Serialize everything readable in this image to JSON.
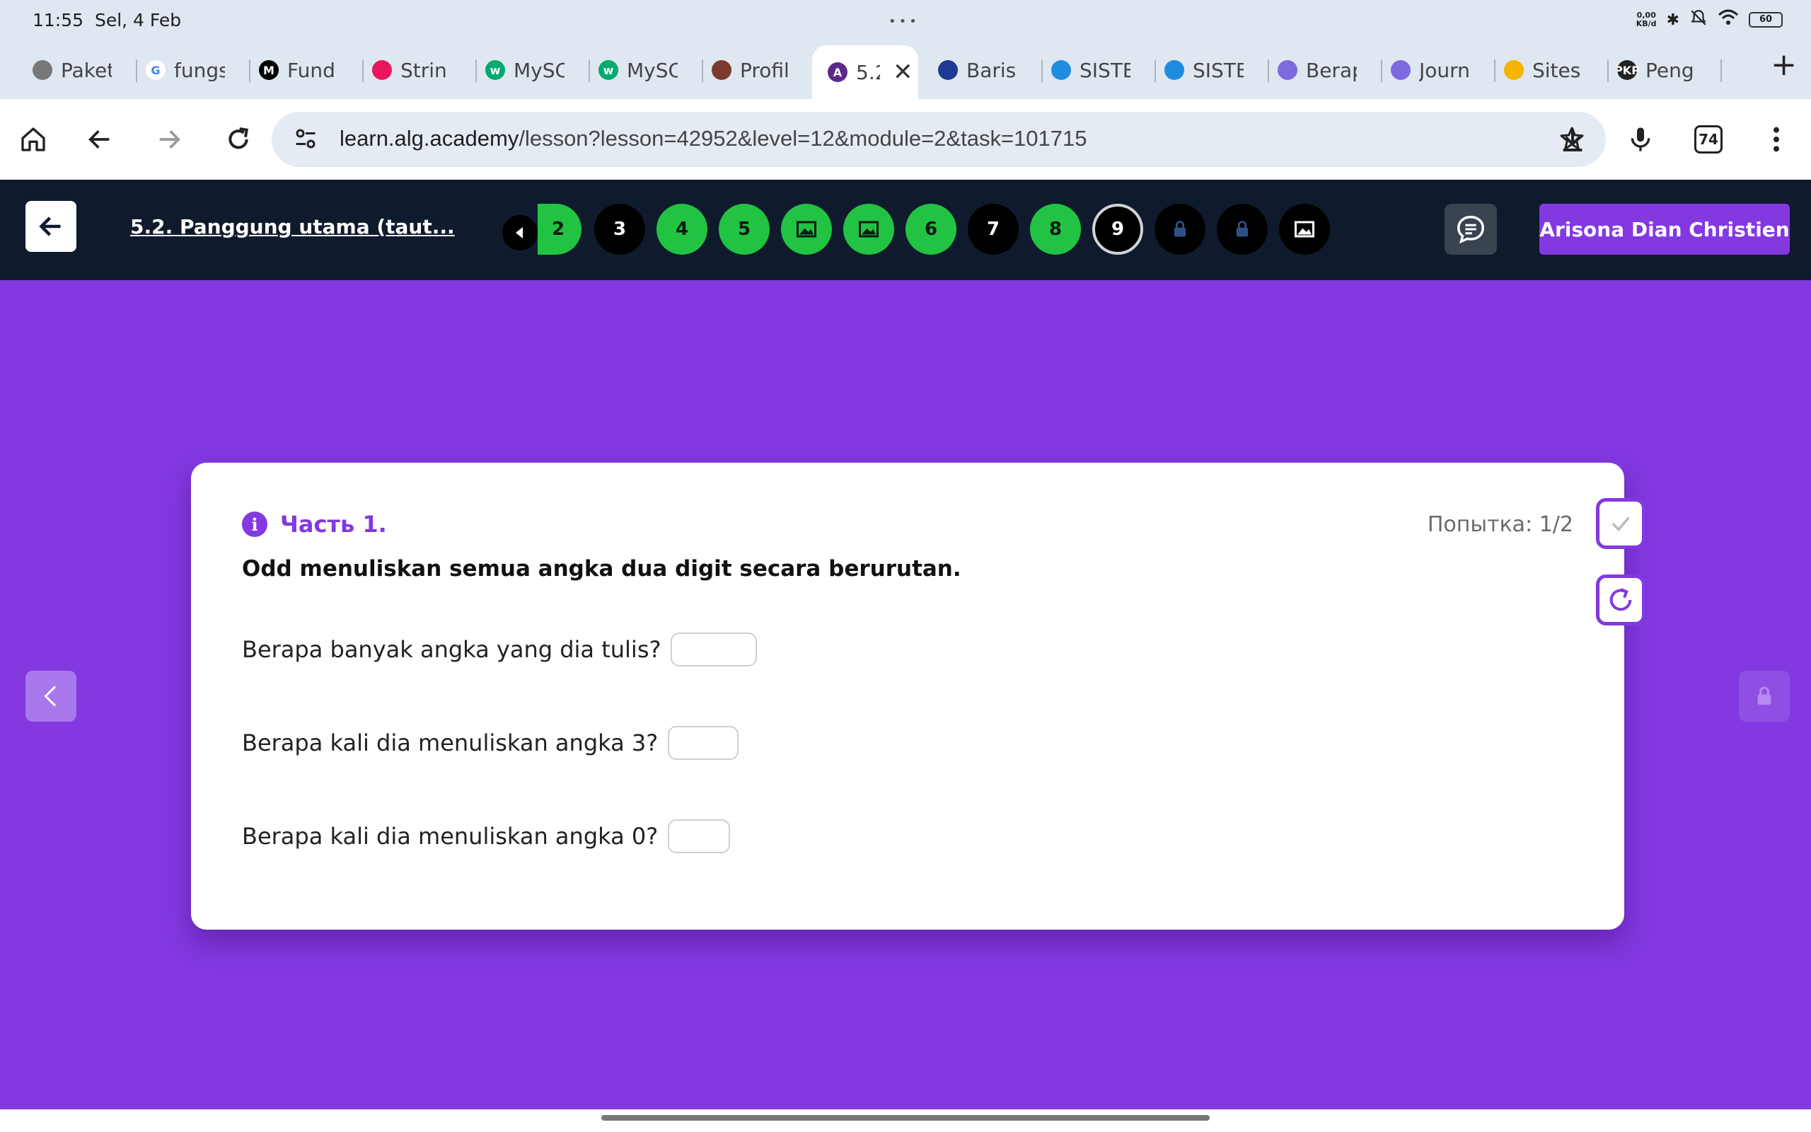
{
  "status": {
    "time": "11:55",
    "date": "Sel, 4 Feb",
    "net_top": "0,00",
    "net_bottom": "KB/d",
    "battery": "60"
  },
  "tabs": [
    {
      "label": "Paket",
      "fav_color": "#777777",
      "fav_text": ""
    },
    {
      "label": "fungs",
      "fav_color": "#ffffff",
      "fav_text": "G"
    },
    {
      "label": "Fund",
      "fav_color": "#000000",
      "fav_text": "M"
    },
    {
      "label": "Strin",
      "fav_color": "#e8175d",
      "fav_text": ""
    },
    {
      "label": "MySC",
      "fav_color": "#04aa6d",
      "fav_text": "w"
    },
    {
      "label": "MySC",
      "fav_color": "#04aa6d",
      "fav_text": "w"
    },
    {
      "label": "Profil",
      "fav_color": "#7a3b2e",
      "fav_text": ""
    },
    {
      "label": "5.2",
      "fav_color": "#5b2a86",
      "fav_text": "A",
      "active": true
    },
    {
      "label": "Baris",
      "fav_color": "#1f3a93",
      "fav_text": ""
    },
    {
      "label": "SISTE",
      "fav_color": "#1f8ce0",
      "fav_text": ""
    },
    {
      "label": "SISTE",
      "fav_color": "#1f8ce0",
      "fav_text": ""
    },
    {
      "label": "Berap",
      "fav_color": "#7d6ae0",
      "fav_text": ""
    },
    {
      "label": "Journ",
      "fav_color": "#7d6ae0",
      "fav_text": ""
    },
    {
      "label": "Sites",
      "fav_color": "#f4b400",
      "fav_text": ""
    },
    {
      "label": "Peng",
      "fav_color": "#222222",
      "fav_text": "PKP"
    }
  ],
  "browser": {
    "url_host": "learn.alg.academy",
    "url_path": "/lesson?lesson=42952&level=12&module=2&task=101715",
    "tab_count": "74"
  },
  "header": {
    "lesson_title": "5.2. Panggung utama (taut...",
    "partial_step": "2",
    "steps": [
      {
        "label": "3",
        "state": "black"
      },
      {
        "label": "4",
        "state": "green"
      },
      {
        "label": "5",
        "state": "green"
      },
      {
        "label": "",
        "state": "green-image"
      },
      {
        "label": "",
        "state": "green-image"
      },
      {
        "label": "6",
        "state": "green"
      },
      {
        "label": "7",
        "state": "black"
      },
      {
        "label": "8",
        "state": "green"
      },
      {
        "label": "9",
        "state": "current"
      },
      {
        "label": "",
        "state": "locked"
      },
      {
        "label": "",
        "state": "locked"
      },
      {
        "label": "",
        "state": "black-image"
      }
    ],
    "user_name": "Arisona Dian Christien"
  },
  "task": {
    "part_label": "Часть 1.",
    "attempt": "Попытка: 1/2",
    "statement": "Odd menuliskan semua angka dua digit secara berurutan.",
    "questions": [
      {
        "text": "Berapa banyak angka yang dia tulis?",
        "value": ""
      },
      {
        "text": "Berapa kali dia menuliskan angka 3?",
        "value": ""
      },
      {
        "text": "Berapa kali dia menuliskan angka 0?",
        "value": ""
      }
    ]
  }
}
